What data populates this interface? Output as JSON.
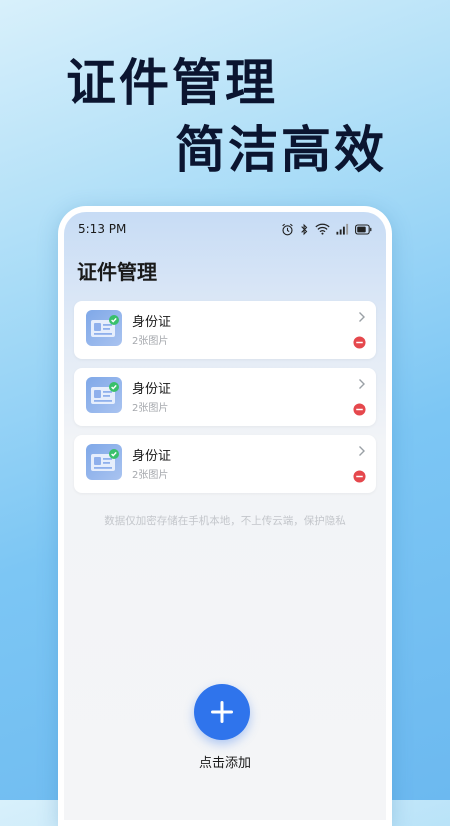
{
  "hero": {
    "line1": "证件管理",
    "line2": "简洁高效"
  },
  "status_bar": {
    "time": "5:13 PM",
    "icons": [
      "alarm-icon",
      "bluetooth-icon",
      "wifi-icon",
      "signal-icon",
      "battery-icon"
    ]
  },
  "page": {
    "title": "证件管理"
  },
  "documents": [
    {
      "name": "身份证",
      "count": "2张图片"
    },
    {
      "name": "身份证",
      "count": "2张图片"
    },
    {
      "name": "身份证",
      "count": "2张图片"
    }
  ],
  "privacy_note": "数据仅加密存储在手机本地，不上传云端，保护隐私",
  "add": {
    "label": "点击添加"
  },
  "colors": {
    "accent": "#2f74ec",
    "remove": "#e5484d",
    "hero_text": "#0b1530"
  }
}
